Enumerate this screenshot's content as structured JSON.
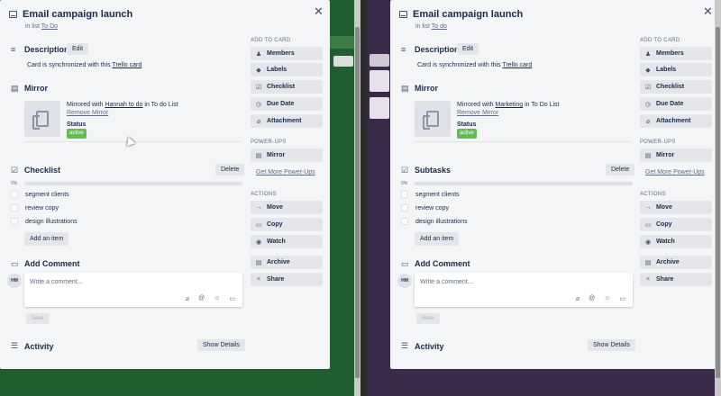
{
  "left": {
    "title": "Email campaign launch",
    "in_list_prefix": "in list",
    "in_list_link": "To Do",
    "description_title": "Description",
    "edit_label": "Edit",
    "desc_prefix": "Card is synchronized with this",
    "desc_link": "Trello card",
    "mirror_title": "Mirror",
    "mirrored_prefix": "Mirrored with",
    "mirrored_link": "Hannah to do",
    "mirrored_suffix": "in To do List",
    "remove_mirror": "Remove Mirror",
    "status_label": "Status",
    "status_value": "active",
    "checklist_title": "Checklist",
    "delete_label": "Delete",
    "percent": "0%",
    "progress": 0,
    "items": [
      "segment clients",
      "review copy",
      "design illustrations"
    ],
    "add_item": "Add an item",
    "add_comment_title": "Add Comment",
    "avatar": "HM",
    "comment_placeholder": "Write a comment...",
    "save_label": "Save",
    "activity_title": "Activity",
    "show_details": "Show Details"
  },
  "right": {
    "title": "Email campaign launch",
    "in_list_prefix": "in list",
    "in_list_link": "To do",
    "description_title": "Description",
    "edit_label": "Edit",
    "desc_prefix": "Card is synchronized with this",
    "desc_link": "Trello card",
    "mirror_title": "Mirror",
    "mirrored_prefix": "Mirrored with",
    "mirrored_link": "Marketing",
    "mirrored_suffix": "in To Do List",
    "remove_mirror": "Remove Mirror",
    "status_label": "Status",
    "status_value": "active",
    "checklist_title": "Subtasks",
    "delete_label": "Delete",
    "percent": "0%",
    "progress": 0,
    "items": [
      "segment clients",
      "review copy",
      "design illustrations"
    ],
    "add_item": "Add an item",
    "add_comment_title": "Add Comment",
    "avatar": "HM",
    "comment_placeholder": "Write a comment...",
    "save_label": "Save",
    "activity_title": "Activity",
    "show_details": "Show Details"
  },
  "sidebar": {
    "add_to_card": "ADD TO CARD",
    "members": "Members",
    "labels": "Labels",
    "checklist": "Checklist",
    "due_date": "Due Date",
    "attachment": "Attachment",
    "power_ups": "POWER-UPS",
    "mirror": "Mirror",
    "get_more": "Get More Power-Ups",
    "actions": "ACTIONS",
    "move": "Move",
    "copy": "Copy",
    "watch": "Watch",
    "archive": "Archive",
    "share": "Share"
  },
  "colors": {
    "left_board": "#1f5e2e",
    "right_board": "#3c2a4a",
    "status_green": "#61bd4f"
  }
}
